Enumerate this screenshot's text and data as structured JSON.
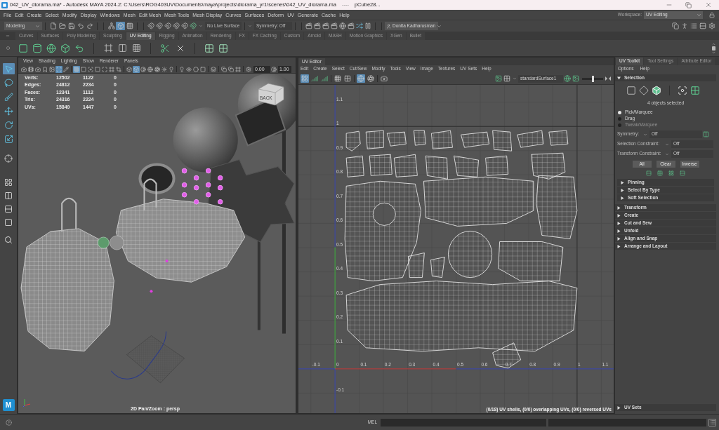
{
  "window": {
    "title": "042_UV_diorama.ma* - Autodesk MAYA 2024.2: C:\\Users\\ROG403UV\\Documents\\maya\\projects\\diorama_yr1\\scenes\\042_UV_diorama.ma",
    "separator": "----",
    "object": "pCube28..."
  },
  "menu_bar": {
    "items": [
      "File",
      "Edit",
      "Create",
      "Select",
      "Modify",
      "Display",
      "Windows",
      "Mesh",
      "Edit Mesh",
      "Mesh Tools",
      "Mesh Display",
      "Curves",
      "Surfaces",
      "Deform",
      "UV",
      "Generate",
      "Cache",
      "Help"
    ],
    "workspace_label": "Workspace:",
    "workspace": "UV Editing"
  },
  "status_line": {
    "menu_set": "Modeling",
    "selection_modes": [
      {
        "kind": "hierarchy",
        "selected": false
      },
      {
        "kind": "object",
        "selected": true
      },
      {
        "kind": "component",
        "selected": false
      }
    ],
    "live_surface": "No Live Surface",
    "symmetry": "Symmetry: Off",
    "user": "Donita Kadharusman"
  },
  "shelf": {
    "tabs": [
      {
        "label": "Curves",
        "selected": false
      },
      {
        "label": "Surfaces",
        "selected": false
      },
      {
        "label": "Poly Modeling",
        "selected": false
      },
      {
        "label": "Sculpting",
        "selected": false
      },
      {
        "label": "UV Editing",
        "selected": true
      },
      {
        "label": "Rigging",
        "selected": false
      },
      {
        "label": "Animation",
        "selected": false
      },
      {
        "label": "Rendering",
        "selected": false
      },
      {
        "label": "FX",
        "selected": false
      },
      {
        "label": "FX Caching",
        "selected": false
      },
      {
        "label": "Custom",
        "selected": false
      },
      {
        "label": "Arnold",
        "selected": false
      },
      {
        "label": "MASH",
        "selected": false
      },
      {
        "label": "Motion Graphics",
        "selected": false
      },
      {
        "label": "XGen",
        "selected": false
      },
      {
        "label": "Bullet",
        "selected": false
      }
    ]
  },
  "toolbox": [
    {
      "kind": "select",
      "selected": true
    },
    {
      "kind": "lasso",
      "selected": false
    },
    {
      "kind": "paint",
      "selected": false
    },
    {
      "kind": "move",
      "selected": false
    },
    {
      "kind": "rotate",
      "selected": false
    },
    {
      "kind": "scale",
      "selected": false
    },
    {
      "kind": "last",
      "selected": false
    }
  ],
  "logo": "M",
  "viewport": {
    "menu": [
      "View",
      "Shading",
      "Lighting",
      "Show",
      "Renderer",
      "Panels"
    ],
    "toolbar": [
      [
        {
          "kind": "camera",
          "on": false
        },
        {
          "kind": "film",
          "on": false
        },
        {
          "kind": "camera",
          "on": false
        },
        {
          "kind": "bookmark",
          "on": false
        },
        {
          "kind": "image",
          "on": false
        },
        {
          "kind": "pan",
          "on": true
        },
        {
          "kind": "pencil",
          "on": false
        }
      ],
      [
        {
          "kind": "grid",
          "on": true
        },
        {
          "kind": "square",
          "on": false
        },
        {
          "kind": "focus",
          "on": false
        },
        {
          "kind": "square",
          "on": false
        },
        {
          "kind": "maximize",
          "on": false
        },
        {
          "kind": "frame",
          "on": false
        },
        {
          "kind": "crop",
          "on": false
        }
      ],
      [
        {
          "kind": "cube",
          "on": false
        },
        {
          "kind": "cube",
          "on": true
        },
        {
          "kind": "contrast",
          "on": false
        },
        {
          "kind": "globe",
          "on": false
        },
        {
          "kind": "aperture",
          "on": false
        },
        {
          "kind": "sun",
          "on": false
        },
        {
          "kind": "bulb",
          "on": false
        }
      ],
      [
        {
          "kind": "bulb",
          "on": false
        },
        {
          "kind": "eye",
          "on": false
        },
        {
          "kind": "circle",
          "on": false
        },
        {
          "kind": "square",
          "on": false
        }
      ],
      [
        {
          "kind": "layers",
          "on": false
        }
      ],
      [
        {
          "kind": "copy",
          "on": false
        },
        {
          "kind": "copy",
          "on": false
        },
        {
          "kind": "frame",
          "on": false
        }
      ]
    ],
    "exposure": "0.00",
    "gamma": "1.00",
    "stats": [
      {
        "label": "Verts:",
        "values": [
          "12502",
          "1122",
          "0"
        ]
      },
      {
        "label": "Edges:",
        "values": [
          "24812",
          "2234",
          "0"
        ]
      },
      {
        "label": "Faces:",
        "values": [
          "12341",
          "1112",
          "0"
        ]
      },
      {
        "label": "Tris:",
        "values": [
          "24316",
          "2224",
          "0"
        ]
      },
      {
        "label": "UVs:",
        "values": [
          "15849",
          "1447",
          "0"
        ]
      }
    ],
    "view_cube": "BACK",
    "camera": "2D Pan/Zoom : persp"
  },
  "uv_editor": {
    "tab": "UV Editor",
    "menu": [
      "Edit",
      "Create",
      "Select",
      "Cut/Sew",
      "Modify",
      "Tools",
      "View",
      "Image",
      "Textures",
      "UV Sets",
      "Help"
    ],
    "toolbar": [
      [
        {
          "kind": "layout",
          "on": true
        },
        {
          "kind": "signal",
          "on": false
        },
        {
          "kind": "signal",
          "on": false
        }
      ],
      [
        {
          "kind": "grid",
          "on": false
        },
        {
          "kind": "checker",
          "on": false
        }
      ],
      [
        {
          "kind": "globe",
          "on": true
        },
        {
          "kind": "aperture",
          "on": false
        }
      ],
      [
        {
          "kind": "camera",
          "on": false
        }
      ]
    ],
    "shader": "standardSurface1",
    "dim": {
      "level": 0.5
    },
    "u_ticks": [
      "-0.1",
      "0",
      "0.1",
      "0.2",
      "0.3",
      "0.4",
      "0.5",
      "0.6",
      "0.7",
      "0.8",
      "0.9",
      "1",
      "1.1"
    ],
    "v_ticks": [
      "1.1",
      "1",
      "0.9",
      "0.8",
      "0.7",
      "0.6",
      "0.5",
      "0.4",
      "0.3",
      "0.2",
      "0.1",
      "-0.1"
    ],
    "summary": "(0/18) UV shells, (0/0) overlapping UVs, (0/0) reversed UVs"
  },
  "uv_toolkit": {
    "tabs": [
      {
        "label": "UV Toolkit",
        "selected": true
      },
      {
        "label": "Tool Settings",
        "selected": false
      },
      {
        "label": "Attribute Editor",
        "selected": false
      }
    ],
    "menu": [
      "Options",
      "Help"
    ],
    "selection": {
      "title": "Selection",
      "expanded": true,
      "modes": [
        {
          "kind": "square",
          "selected": false
        },
        {
          "kind": "diamond",
          "selected": false
        },
        {
          "kind": "cube",
          "selected": true
        }
      ],
      "summary": "4 objects selected",
      "methods": [
        {
          "label": "Pick/Marquee",
          "selected": true,
          "disabled": false
        },
        {
          "label": "Drag",
          "selected": false,
          "disabled": false
        },
        {
          "label": "Tweak/Marquee",
          "selected": false,
          "disabled": true
        }
      ],
      "fields": [
        {
          "label": "Symmetry:",
          "value": "Off"
        },
        {
          "label": "Selection Constraint:",
          "value": "Off"
        },
        {
          "label": "Transform Constraint:",
          "value": "Off"
        }
      ],
      "buttons": [
        "All",
        "Clear",
        "Inverse"
      ],
      "subsections": [
        {
          "title": "Pinning",
          "expanded": false
        },
        {
          "title": "Select By Type",
          "expanded": false
        },
        {
          "title": "Soft Selection",
          "expanded": false
        }
      ]
    },
    "sections": [
      {
        "title": "Transform",
        "expanded": false
      },
      {
        "title": "Create",
        "expanded": false
      },
      {
        "title": "Cut and Sew",
        "expanded": false
      },
      {
        "title": "Unfold",
        "expanded": false
      },
      {
        "title": "Align and Snap",
        "expanded": false
      },
      {
        "title": "Arrange and Layout",
        "expanded": false
      }
    ],
    "footer": {
      "title": "UV Sets",
      "expanded": false
    }
  },
  "command_line": {
    "language": "MEL"
  }
}
